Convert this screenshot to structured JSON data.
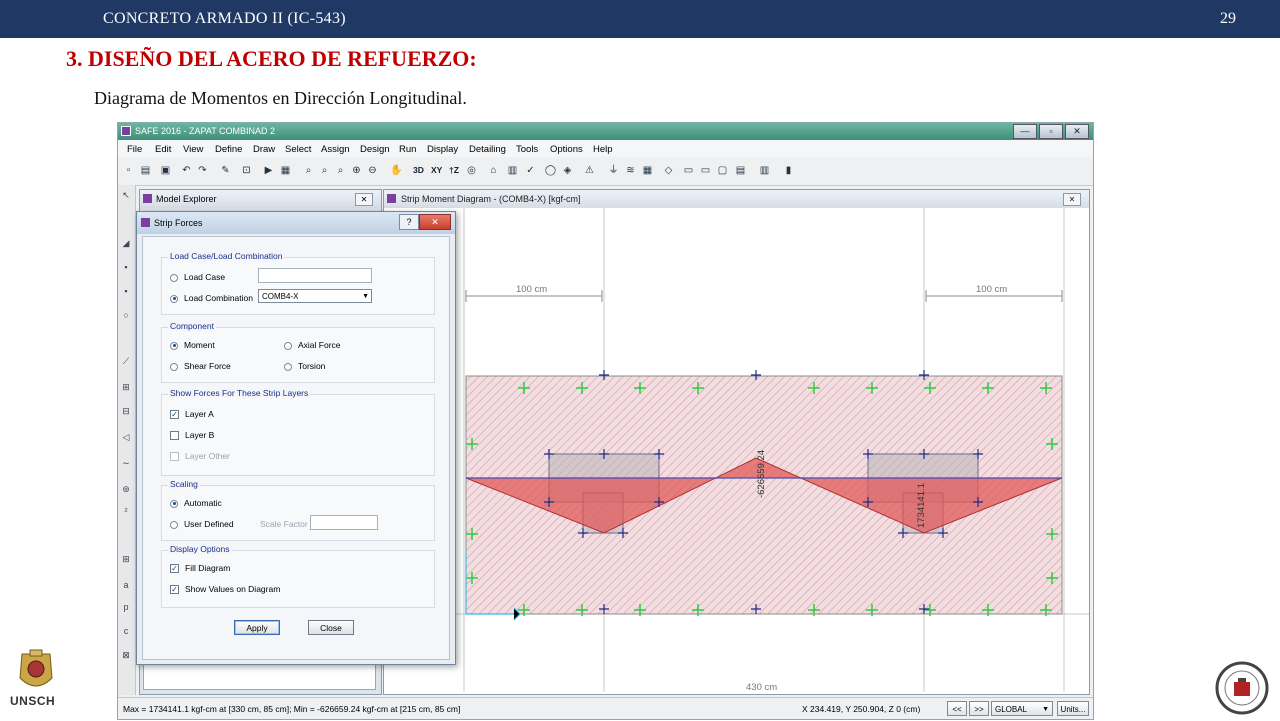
{
  "slide": {
    "header_course": "CONCRETO ARMADO II (IC-543)",
    "page_number": "29",
    "title": "3. DISEÑO DEL ACERO DE REFUERZO:",
    "subtitle": "Diagrama de Momentos en Dirección Longitudinal."
  },
  "app": {
    "window_title": "SAFE 2016 - ZAPAT COMBINAD 2",
    "window_buttons": [
      "—",
      "▫",
      "✕"
    ],
    "menu": [
      "File",
      "Edit",
      "View",
      "Define",
      "Draw",
      "Select",
      "Assign",
      "Design",
      "Run",
      "Display",
      "Detailing",
      "Tools",
      "Options",
      "Help"
    ],
    "toolbar_text": {
      "three_d": "3D",
      "xy": "XY",
      "iz": "†Z"
    }
  },
  "model_explorer": {
    "title": "Model Explorer",
    "close": "✕"
  },
  "diagram_window": {
    "title": "Strip Moment Diagram   - (COMB4-X)  [kgf-cm]",
    "close": "✕",
    "dim_left": "100 cm",
    "dim_right": "100 cm",
    "dim_bottom": "430 cm",
    "value_min": "-626659.24",
    "value_max": "1734141.1"
  },
  "strip_forces": {
    "title": "Strip Forces",
    "help": "?",
    "close": "✕",
    "load_group": {
      "label": "Load Case/Load Combination",
      "option_case": "Load Case",
      "option_combo": "Load Combination",
      "combo_value": "COMB4-X",
      "selected": "Load Combination"
    },
    "component_group": {
      "label": "Component",
      "moment": "Moment",
      "axial": "Axial Force",
      "shear": "Shear Force",
      "torsion": "Torsion",
      "selected": "Moment"
    },
    "layers_group": {
      "label": "Show Forces For These Strip Layers",
      "layer_a": "Layer A",
      "layer_b": "Layer B",
      "layer_other": "Layer Other",
      "layer_a_checked": true,
      "layer_b_checked": false,
      "layer_other_enabled": false
    },
    "scaling_group": {
      "label": "Scaling",
      "automatic": "Automatic",
      "user_defined": "User Defined",
      "scale_factor": "Scale Factor",
      "selected": "Automatic"
    },
    "display_group": {
      "label": "Display Options",
      "fill": "Fill Diagram",
      "show_values": "Show Values on Diagram",
      "fill_checked": true,
      "show_values_checked": true
    },
    "apply": "Apply",
    "close_btn": "Close"
  },
  "statusbar": {
    "minmax": "Max = 1734141.1 kgf-cm at [330 cm, 85 cm];  Min = -626659.24 kgf-cm at [215 cm, 85 cm]",
    "coords": "X 234.419,  Y 250.904,  Z 0  (cm)",
    "nav_prev": "<<",
    "nav_next": ">>",
    "coord_system": "GLOBAL",
    "units_btn": "Units..."
  },
  "logos": {
    "left_text": "UNSCH",
    "right_icon": "university-seal-icon"
  },
  "colors": {
    "header_bg": "#1f3864",
    "title_red": "#c00000",
    "diagram_fill": "#e05a5a",
    "hatch": "#c9a0a6",
    "point_green": "#2ecc40",
    "point_blue": "#1b2a8a"
  }
}
